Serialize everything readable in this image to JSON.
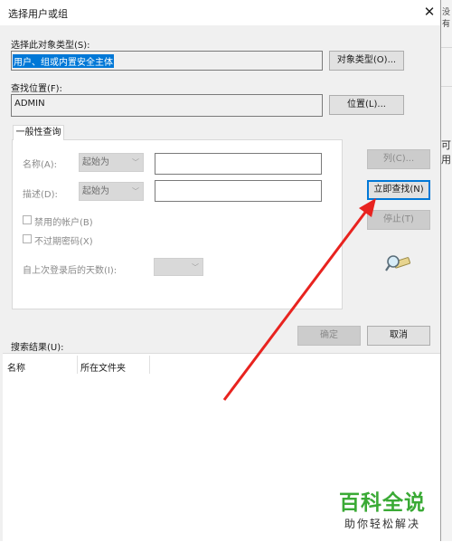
{
  "background_window": {
    "top_text": "没有",
    "side_text": "可用"
  },
  "dialog": {
    "title": "选择用户或组",
    "close_icon": "close-icon"
  },
  "object_type": {
    "label": "选择此对象类型(S):",
    "value": "用户、组或内置安全主体",
    "button": "对象类型(O)..."
  },
  "location": {
    "label": "查找位置(F):",
    "value": "ADMIN",
    "button": "位置(L)..."
  },
  "query_tab": {
    "tab_label": "一般性查询",
    "name_label": "名称(A):",
    "name_mode": "起始为",
    "desc_label": "描述(D):",
    "desc_mode": "起始为",
    "disabled_accounts": "禁用的帐户(B)",
    "no_expire_pwd": "不过期密码(X)",
    "days_since_login": "自上次登录后的天数(I):"
  },
  "side_buttons": {
    "columns": "列(C)...",
    "find_now": "立即查找(N)",
    "stop": "停止(T)",
    "search_icon": "magnifier-icon"
  },
  "actions": {
    "ok": "确定",
    "cancel": "取消"
  },
  "results": {
    "label": "搜索结果(U):",
    "columns": [
      "名称",
      "所在文件夹"
    ]
  },
  "watermark": {
    "brand": "百科全说",
    "slogan": "助你轻松解决"
  },
  "colors": {
    "selection": "#0078d7",
    "annotation_arrow": "#e8231f",
    "watermark_green": "#3aaa35"
  }
}
